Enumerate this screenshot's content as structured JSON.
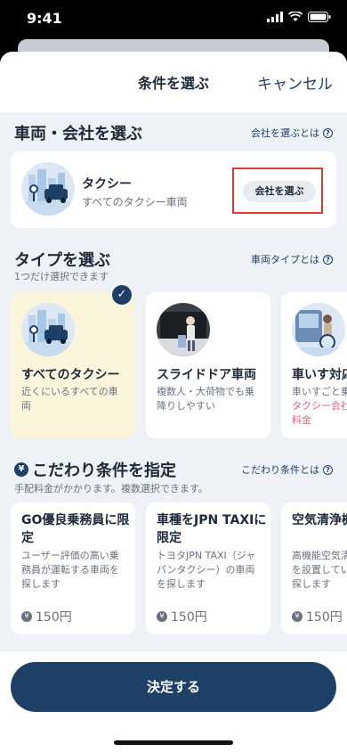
{
  "status_bar": {
    "time": "9:41"
  },
  "header": {
    "title": "条件を選ぶ",
    "cancel_label": "キャンセル"
  },
  "vehicle_section": {
    "title": "車両・会社を選ぶ",
    "help_link": "会社を選ぶとは",
    "company": {
      "name": "タクシー",
      "description": "すべてのタクシー車両",
      "choose_button": "会社を選ぶ"
    }
  },
  "type_section": {
    "title": "タイプを選ぶ",
    "subtitle": "1つだけ選択できます",
    "help_link": "車両タイプとは",
    "types": [
      {
        "name": "すべてのタクシー",
        "description": "近くにいるすべての車両",
        "selected": true
      },
      {
        "name": "スライドドア車両",
        "description": "複数人・大荷物でも乗降りしやすい",
        "selected": false
      },
      {
        "name": "車いす対応",
        "description": "車いすごと乗",
        "warning": "タクシー会社車両指定料金",
        "selected": false
      }
    ]
  },
  "preference_section": {
    "title": "こだわり条件を指定",
    "subtitle": "手配料金がかかります。複数選択できます。",
    "help_link": "こだわり条件とは",
    "items": [
      {
        "name": "GO優良乗務員に限定",
        "description": "ユーザー評価の高い乗務員が運転する車両を探します",
        "price": "150円"
      },
      {
        "name": "車種をJPN TAXIに限定",
        "description": "トヨタJPN TAXI（ジャパンタクシー）の車両を探します",
        "price": "150円"
      },
      {
        "name": "空気清浄機搭載車両",
        "description": "高機能空気清浄機などを設置している車両を探します",
        "price": "150円"
      }
    ]
  },
  "footer": {
    "submit_label": "決定する"
  },
  "colors": {
    "primary": "#1e3f66",
    "highlight": "#e23b2f",
    "selected_bg": "#fbf5dc"
  }
}
